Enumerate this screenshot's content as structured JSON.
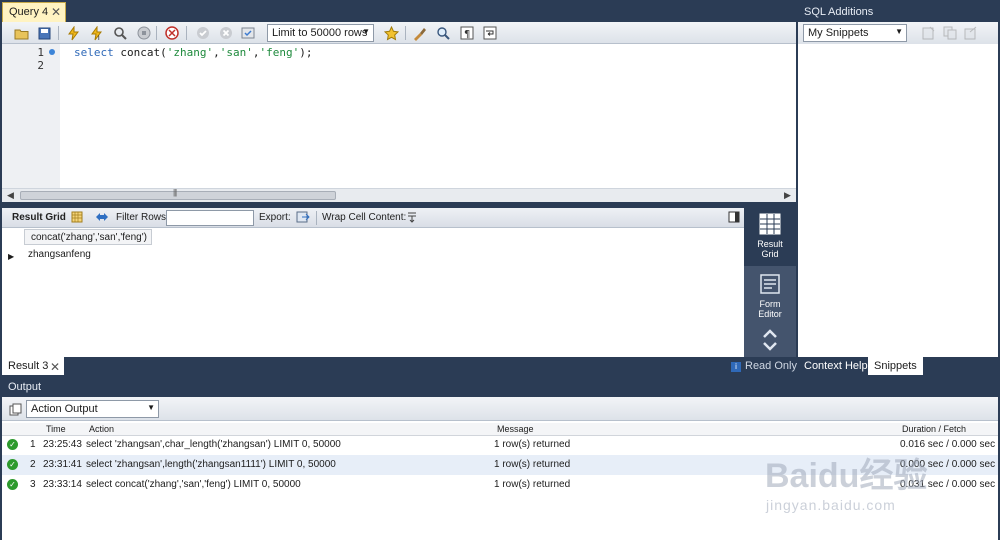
{
  "query_tab": {
    "label": "Query 4",
    "close": "✕"
  },
  "toolbar": {
    "limit_select": "Limit to 50000 rows"
  },
  "editor": {
    "line_numbers": [
      "1",
      "2"
    ],
    "code_kw": "select",
    "code_fn": "concat(",
    "code_s1": "'zhang'",
    "code_s2": "'san'",
    "code_s3": "'feng'",
    "code_tail": ");",
    "comma": ","
  },
  "result_toolbar": {
    "result_grid": "Result Grid",
    "filter_rows": "Filter Rows:",
    "export": "Export:",
    "wrap": "Wrap Cell Content:"
  },
  "result_grid": {
    "column": "concat('zhang','san','feng')",
    "value": "zhangsanfeng"
  },
  "side_switch": {
    "result_grid": "Result\nGrid",
    "form_editor": "Form\nEditor"
  },
  "additions": {
    "title": "SQL Additions",
    "snippets_select": "My Snippets"
  },
  "bottom_tabs": {
    "result_tab": "Result 3",
    "read_only": "Read Only",
    "context_help": "Context Help",
    "snippets": "Snippets"
  },
  "output": {
    "title": "Output",
    "select": "Action Output",
    "headers": {
      "time": "Time",
      "action": "Action",
      "message": "Message",
      "duration": "Duration / Fetch"
    },
    "rows": [
      {
        "n": "1",
        "time": "23:25:43",
        "action": "select 'zhangsan',char_length('zhangsan') LIMIT 0, 50000",
        "message": "1 row(s) returned",
        "duration": "0.016 sec / 0.000 sec"
      },
      {
        "n": "2",
        "time": "23:31:41",
        "action": "select 'zhangsan',length('zhangsan1111') LIMIT 0, 50000",
        "message": "1 row(s) returned",
        "duration": "0.000 sec / 0.000 sec"
      },
      {
        "n": "3",
        "time": "23:33:14",
        "action": "select concat('zhang','san','feng') LIMIT 0, 50000",
        "message": "1 row(s) returned",
        "duration": "0.031 sec / 0.000 sec"
      }
    ]
  },
  "watermark": {
    "main": "Baidu经验",
    "sub": "jingyan.baidu.com"
  },
  "colors": {
    "chrome": "#2b3c55",
    "ok": "#2e9a2e",
    "alt_row": "#e7eef8"
  }
}
